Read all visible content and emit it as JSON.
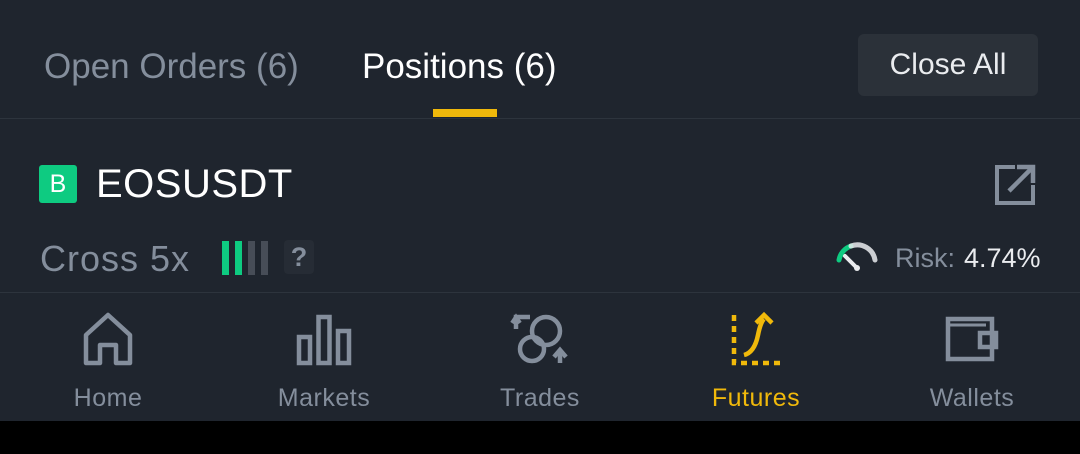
{
  "tabs": {
    "open_orders": "Open Orders (6)",
    "positions": "Positions (6)",
    "active": "positions",
    "close_all": "Close All"
  },
  "position": {
    "side_badge": "B",
    "symbol": "EOSUSDT",
    "margin_mode": "Cross 5x",
    "leverage_level": 0.5,
    "help": "?",
    "risk_label": "Risk:",
    "risk_value": "4.74%",
    "icons": [
      "share-icon",
      "leverage-bars-icon",
      "help-icon",
      "gauge-icon"
    ]
  },
  "nav": {
    "items": [
      {
        "label": "Home",
        "icon": "home-icon"
      },
      {
        "label": "Markets",
        "icon": "bar-chart-icon"
      },
      {
        "label": "Trades",
        "icon": "exchange-icon"
      },
      {
        "label": "Futures",
        "icon": "futures-icon"
      },
      {
        "label": "Wallets",
        "icon": "wallet-icon"
      }
    ],
    "active_index": 3
  },
  "colors": {
    "background": "#1f252e",
    "accent": "#f0b90b",
    "buy": "#0ecb81",
    "text_primary": "#ffffff",
    "text_secondary": "#848e9c",
    "button_bg": "#2b3139"
  }
}
